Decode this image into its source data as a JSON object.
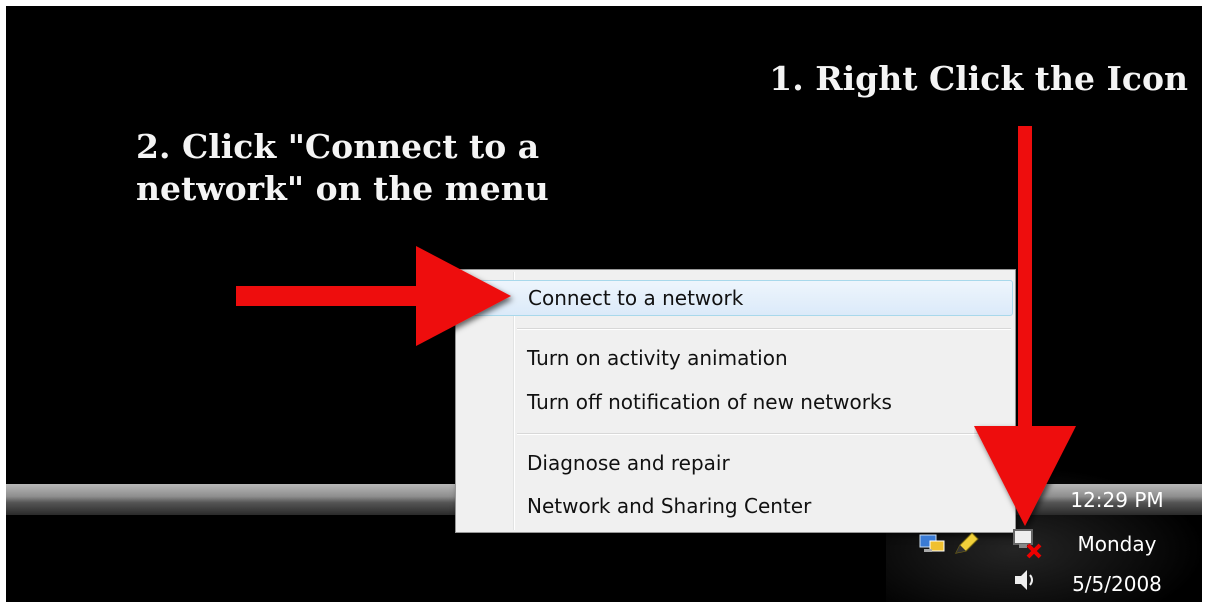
{
  "annotations": {
    "step1": "1. Right Click the Icon",
    "step2": "2. Click \"Connect to a network\" on the menu"
  },
  "context_menu": {
    "items": [
      {
        "label": "Connect to a network",
        "highlighted": true
      },
      {
        "label": "Turn on activity animation"
      },
      {
        "label": "Turn off notification of new networks"
      },
      {
        "label": "Diagnose and repair"
      },
      {
        "label": "Network and Sharing Center"
      }
    ]
  },
  "tray": {
    "time": "12:29 PM",
    "day": "Monday",
    "date": "5/5/2008",
    "icons": [
      "network-status-icon",
      "pencil-icon",
      "network-disconnected-icon",
      "volume-icon"
    ]
  },
  "colors": {
    "arrow": "#ee1111",
    "desktop": "#000000",
    "menu_highlight": "#dbeaf9"
  }
}
